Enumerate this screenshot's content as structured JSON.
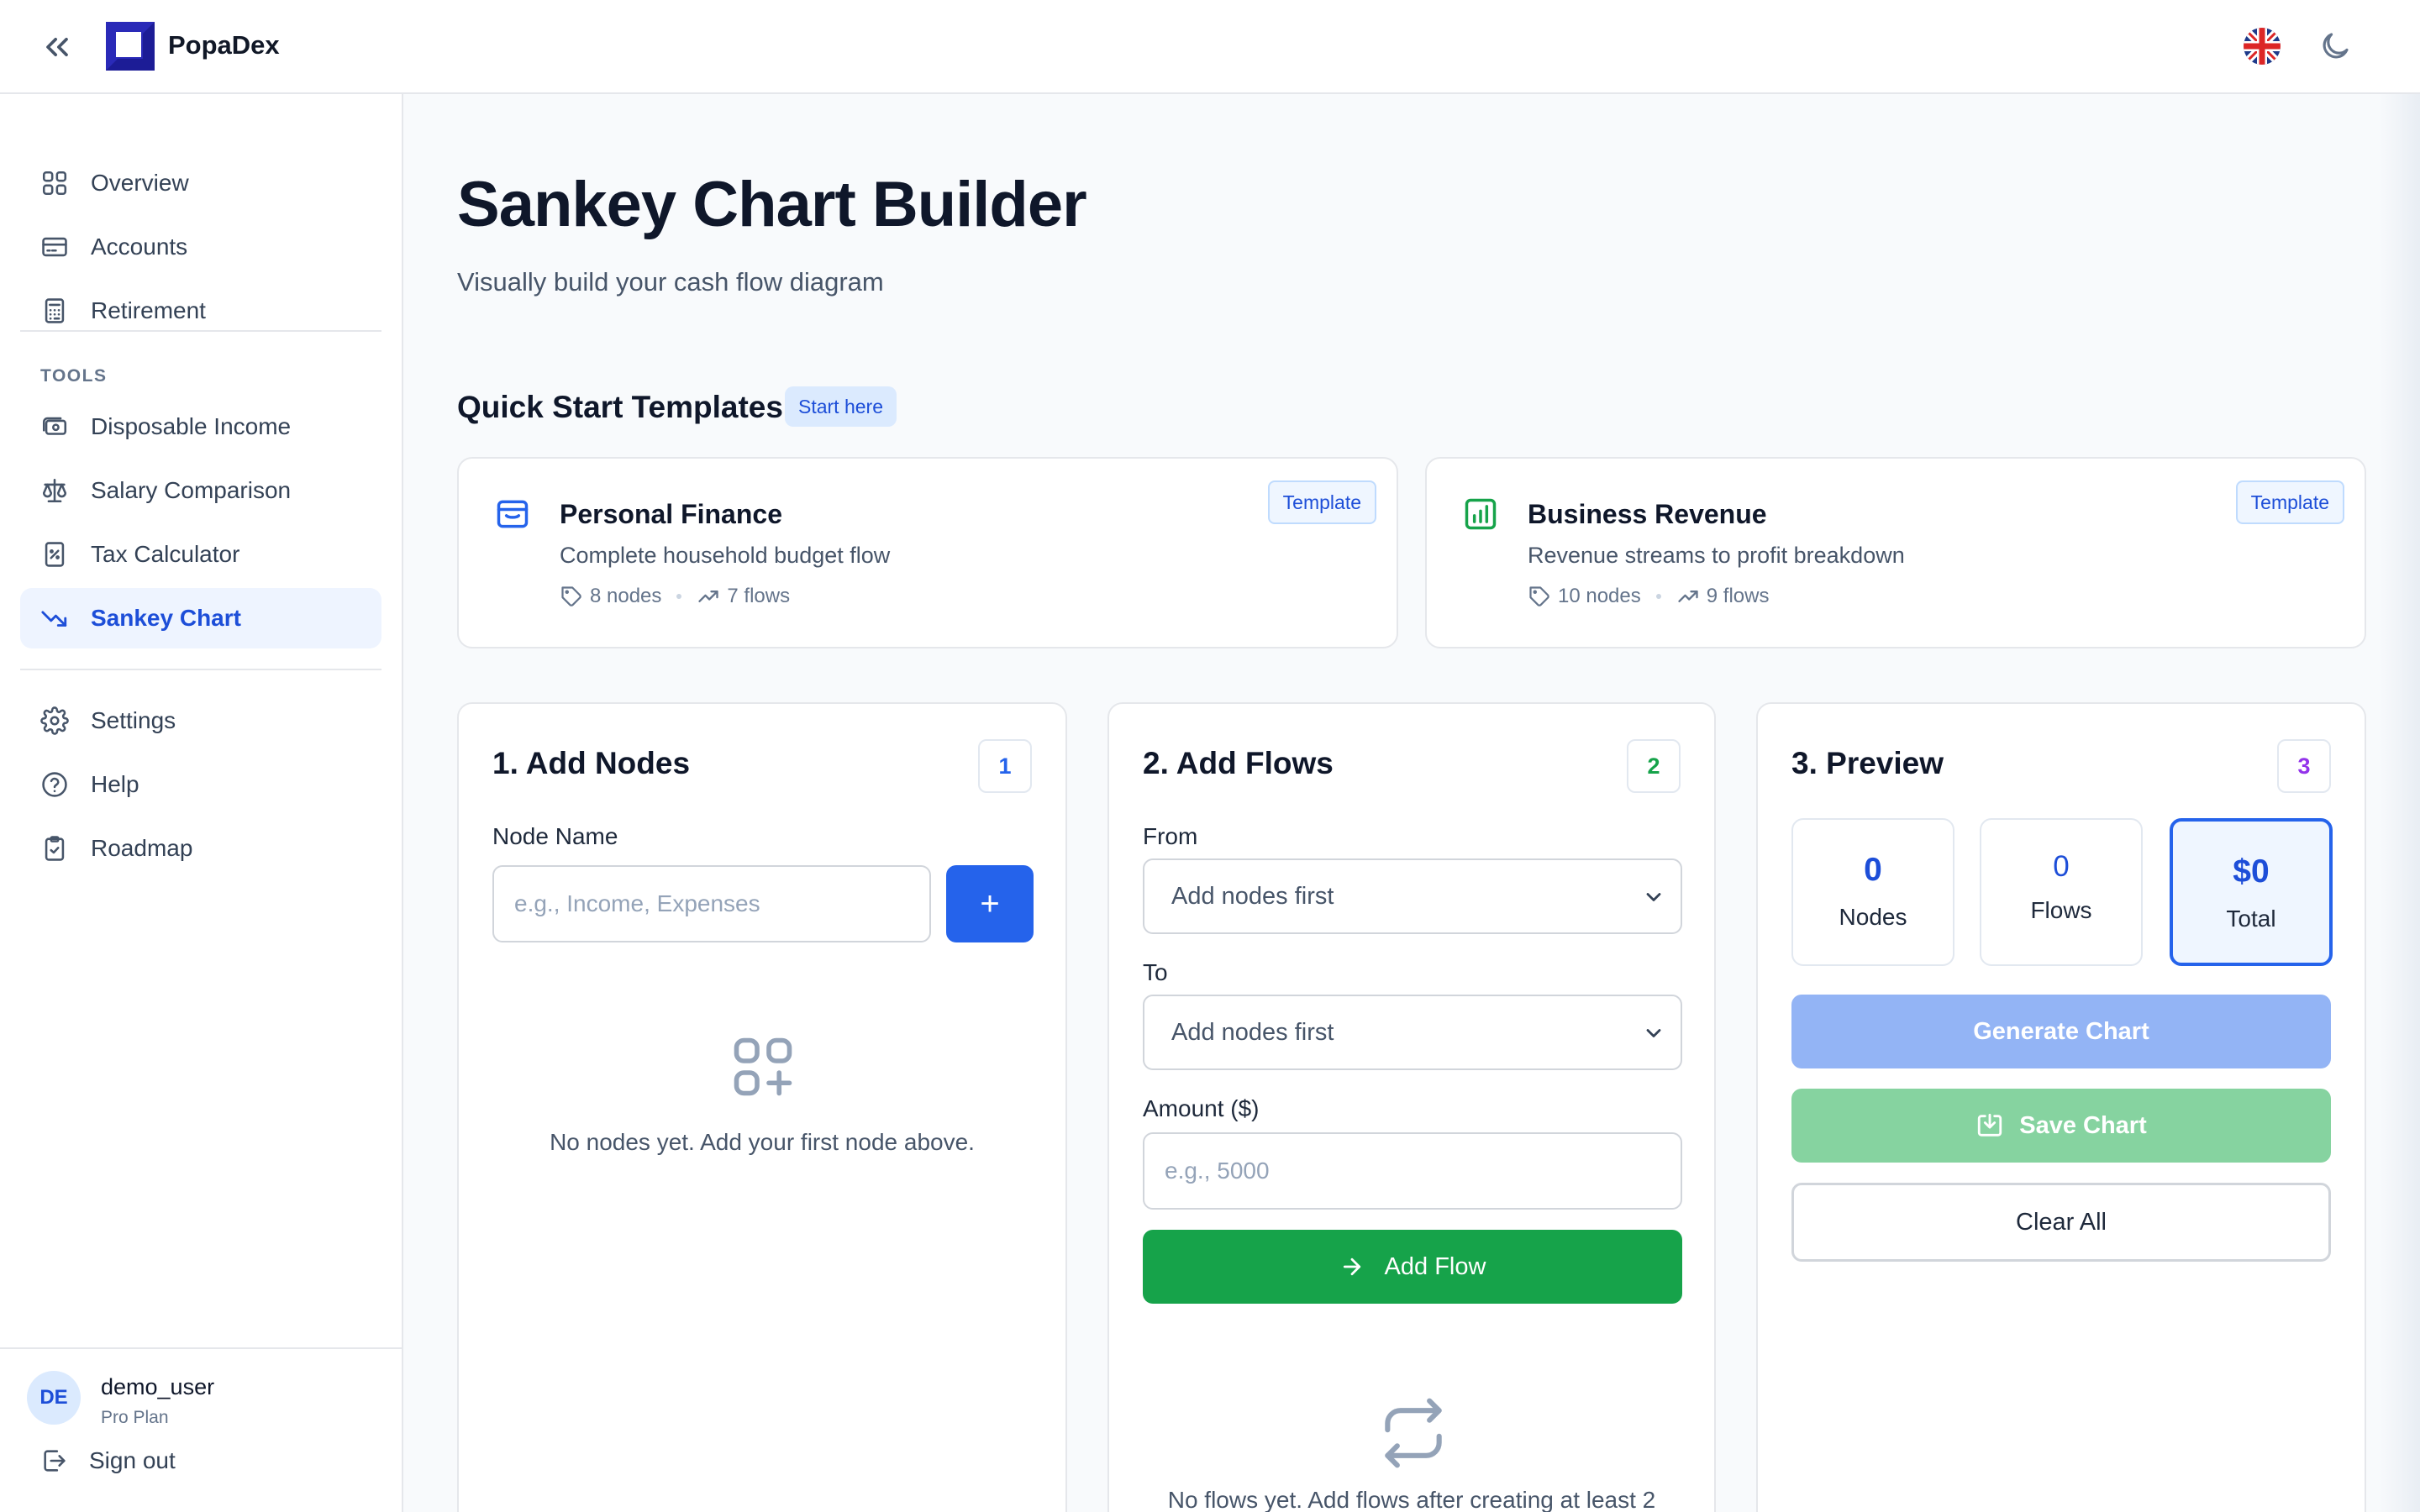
{
  "header": {
    "app_name": "PopaDex",
    "icons": {
      "collapse": "chevrons-left-icon",
      "language": "uk-flag-icon",
      "theme": "moon-icon"
    }
  },
  "sidebar": {
    "primary_items": [
      {
        "label": "Overview",
        "icon": "grid-icon"
      },
      {
        "label": "Accounts",
        "icon": "credit-card-icon"
      },
      {
        "label": "Retirement",
        "icon": "calculator-icon"
      }
    ],
    "tools_label": "TOOLS",
    "tool_items": [
      {
        "label": "Disposable Income",
        "icon": "banknote-icon"
      },
      {
        "label": "Salary Comparison",
        "icon": "scale-icon"
      },
      {
        "label": "Tax Calculator",
        "icon": "receipt-icon"
      },
      {
        "label": "Sankey Chart",
        "icon": "trending-down-icon",
        "active": true
      }
    ],
    "secondary_items": [
      {
        "label": "Settings",
        "icon": "gear-icon"
      },
      {
        "label": "Help",
        "icon": "help-circle-icon"
      },
      {
        "label": "Roadmap",
        "icon": "clipboard-check-icon"
      }
    ],
    "user": {
      "initials": "DE",
      "name": "demo_user",
      "plan": "Pro Plan"
    },
    "sign_out": "Sign out"
  },
  "page": {
    "title": "Sankey Chart Builder",
    "subtitle": "Visually build your cash flow diagram"
  },
  "quick_start": {
    "title": "Quick Start Templates",
    "badge": "Start here",
    "templates": [
      {
        "name": "Personal Finance",
        "description": "Complete household budget flow",
        "nodes": "8 nodes",
        "flows": "7 flows",
        "badge": "Template",
        "icon": "wallet-icon",
        "accent": "#2563eb"
      },
      {
        "name": "Business Revenue",
        "description": "Revenue streams to profit breakdown",
        "nodes": "10 nodes",
        "flows": "9 flows",
        "badge": "Template",
        "icon": "bar-chart-icon",
        "accent": "#16a34a"
      }
    ]
  },
  "nodes_panel": {
    "title": "1. Add Nodes",
    "step": "1",
    "field_label": "Node Name",
    "placeholder": "e.g., Income, Expenses",
    "add_button": "+",
    "empty_text": "No nodes yet. Add your first node above."
  },
  "flows_panel": {
    "title": "2. Add Flows",
    "step": "2",
    "from_label": "From",
    "from_value": "Add nodes first",
    "to_label": "To",
    "to_value": "Add nodes first",
    "amount_label": "Amount ($)",
    "amount_placeholder": "e.g., 5000",
    "add_button": "Add Flow",
    "empty_text": "No flows yet. Add flows after creating at least 2"
  },
  "preview_panel": {
    "title": "3. Preview",
    "step": "3",
    "stats": [
      {
        "value": "0",
        "label": "Nodes"
      },
      {
        "value": "0",
        "label": "Flows"
      },
      {
        "value": "$0",
        "label": "Total"
      }
    ],
    "generate_button": "Generate Chart",
    "save_button": "Save Chart",
    "clear_button": "Clear All"
  },
  "colors": {
    "primary": "#2563eb",
    "primary_disabled": "#93b4f5",
    "success": "#16a34a",
    "success_disabled": "#86d3a0",
    "step2": "#16a34a",
    "step3": "#9333ea"
  }
}
